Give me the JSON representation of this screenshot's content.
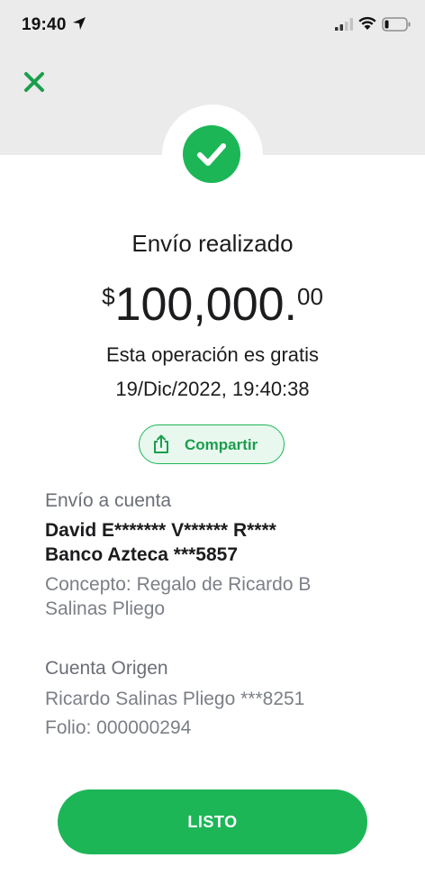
{
  "status_bar": {
    "time": "19:40",
    "icons": [
      "location-arrow-icon",
      "cellular-signal-icon",
      "wifi-icon",
      "battery-icon"
    ]
  },
  "header": {
    "close_icon": "close-icon",
    "success_icon": "checkmark-icon"
  },
  "receipt": {
    "title": "Envío realizado",
    "amount": {
      "currency_symbol": "$",
      "whole": "100,000.",
      "cents": "00"
    },
    "fee_note": "Esta operación es gratis",
    "datetime": "19/Dic/2022, 19:40:38",
    "share_label": "Compartir"
  },
  "destination": {
    "label": "Envío a cuenta",
    "name": "David E******* V****** R****",
    "bank": "Banco Azteca ***5857",
    "concept": "Concepto: Regalo de Ricardo B Salinas Pliego"
  },
  "origin": {
    "label": "Cuenta Origen",
    "account": "Ricardo Salinas Pliego ***8251",
    "folio": "Folio: 000000294"
  },
  "footer": {
    "done_label": "LISTO"
  },
  "colors": {
    "accent": "#1db657",
    "header_bg": "#ebebeb",
    "share_bg": "#e9f8ef"
  }
}
